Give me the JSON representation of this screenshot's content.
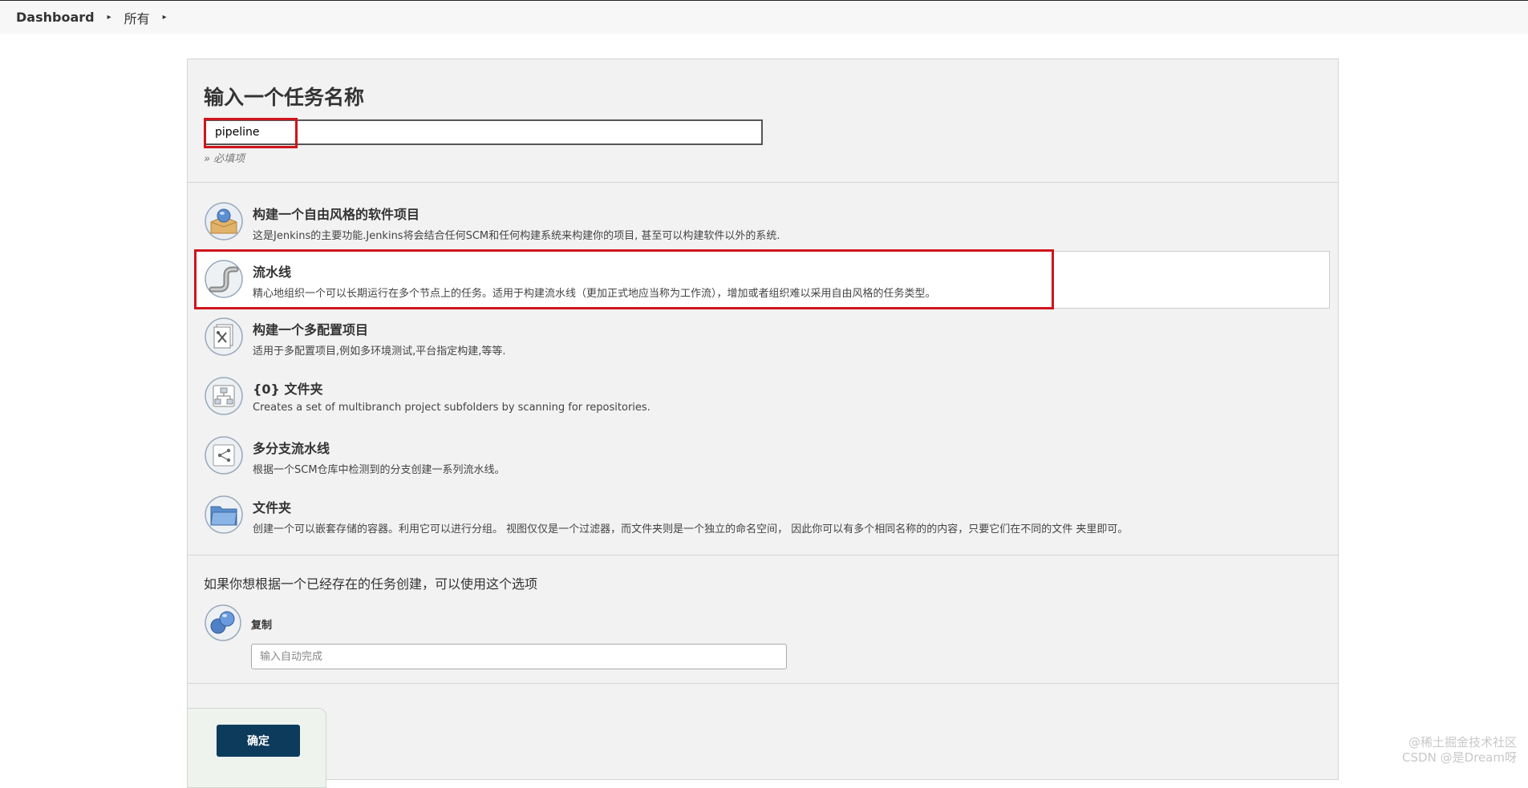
{
  "breadcrumb": {
    "items": [
      "Dashboard",
      "所有"
    ],
    "separator": "▸"
  },
  "form": {
    "title": "输入一个任务名称",
    "name_value": "pipeline",
    "required_note": "» 必填项"
  },
  "job_types": [
    {
      "label": "构建一个自由风格的软件项目",
      "description": "这是Jenkins的主要功能.Jenkins将会结合任何SCM和任何构建系统来构建你的项目, 甚至可以构建软件以外的系统.",
      "icon": "freestyle-project-icon",
      "selected": false
    },
    {
      "label": "流水线",
      "description": "精心地组织一个可以长期运行在多个节点上的任务。适用于构建流水线（更加正式地应当称为工作流），增加或者组织难以采用自由风格的任务类型。",
      "icon": "pipeline-icon",
      "selected": true
    },
    {
      "label": "构建一个多配置项目",
      "description": "适用于多配置项目,例如多环境测试,平台指定构建,等等.",
      "icon": "multi-config-icon",
      "selected": false
    },
    {
      "label": "{0} 文件夹",
      "description": "Creates a set of multibranch project subfolders by scanning for repositories.",
      "icon": "org-folder-icon",
      "selected": false
    },
    {
      "label": "多分支流水线",
      "description": "根据一个SCM仓库中检测到的分支创建一系列流水线。",
      "icon": "multibranch-pipeline-icon",
      "selected": false
    },
    {
      "label": "文件夹",
      "description": "创建一个可以嵌套存储的容器。利用它可以进行分组。 视图仅仅是一个过滤器，而文件夹则是一个独立的命名空间， 因此你可以有多个相同名称的的内容，只要它们在不同的文件 夹里即可。",
      "icon": "folder-icon",
      "selected": false
    }
  ],
  "copy": {
    "heading": "如果你想根据一个已经存在的任务创建，可以使用这个选项",
    "label": "复制",
    "placeholder": "输入自动完成",
    "icon": "copy-icon"
  },
  "ok_button": "确定",
  "watermark": {
    "line1": "@稀土掘金技术社区",
    "line2": "CSDN @是Dream呀"
  },
  "colors": {
    "highlight": "#d0141c",
    "button_bg": "#0d3b5c",
    "panel_bg": "#f2f2f2"
  }
}
